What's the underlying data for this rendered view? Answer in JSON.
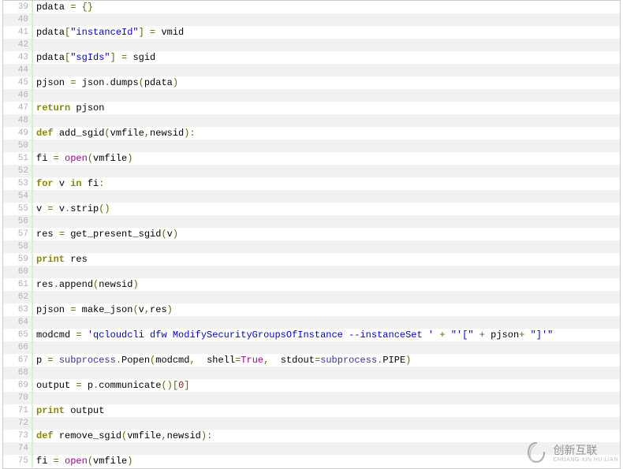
{
  "startLine": 39,
  "watermark": {
    "main": "创新互联",
    "sub": "CHUANG XIN HU LIAN"
  },
  "lines": [
    [
      {
        "t": "pdata",
        "c": "id"
      },
      {
        "t": " "
      },
      {
        "t": "=",
        "c": "op"
      },
      {
        "t": " "
      },
      {
        "t": "{}",
        "c": "punc"
      }
    ],
    [],
    [
      {
        "t": "pdata",
        "c": "id"
      },
      {
        "t": "[",
        "c": "punc"
      },
      {
        "t": "\"instanceId\"",
        "c": "str"
      },
      {
        "t": "]",
        "c": "punc"
      },
      {
        "t": " "
      },
      {
        "t": "=",
        "c": "op"
      },
      {
        "t": " "
      },
      {
        "t": "vmid",
        "c": "id"
      }
    ],
    [],
    [
      {
        "t": "pdata",
        "c": "id"
      },
      {
        "t": "[",
        "c": "punc"
      },
      {
        "t": "\"sgIds\"",
        "c": "str"
      },
      {
        "t": "]",
        "c": "punc"
      },
      {
        "t": " "
      },
      {
        "t": "=",
        "c": "op"
      },
      {
        "t": " "
      },
      {
        "t": "sgid",
        "c": "id"
      }
    ],
    [],
    [
      {
        "t": "pjson",
        "c": "id"
      },
      {
        "t": " "
      },
      {
        "t": "=",
        "c": "op"
      },
      {
        "t": " "
      },
      {
        "t": "json",
        "c": "id"
      },
      {
        "t": ".",
        "c": "punc"
      },
      {
        "t": "dumps",
        "c": "id"
      },
      {
        "t": "(",
        "c": "punc"
      },
      {
        "t": "pdata",
        "c": "id"
      },
      {
        "t": ")",
        "c": "punc"
      }
    ],
    [],
    [
      {
        "t": "return",
        "c": "kw"
      },
      {
        "t": " "
      },
      {
        "t": "pjson",
        "c": "id"
      }
    ],
    [],
    [
      {
        "t": "def",
        "c": "def"
      },
      {
        "t": " "
      },
      {
        "t": "add_sgid",
        "c": "id"
      },
      {
        "t": "(",
        "c": "punc"
      },
      {
        "t": "vmfile",
        "c": "id"
      },
      {
        "t": ",",
        "c": "punc"
      },
      {
        "t": "newsid",
        "c": "id"
      },
      {
        "t": ")",
        "c": "punc"
      },
      {
        "t": ":",
        "c": "punc"
      }
    ],
    [],
    [
      {
        "t": "fi",
        "c": "id"
      },
      {
        "t": " "
      },
      {
        "t": "=",
        "c": "op"
      },
      {
        "t": " "
      },
      {
        "t": "open",
        "c": "builtin"
      },
      {
        "t": "(",
        "c": "punc"
      },
      {
        "t": "vmfile",
        "c": "id"
      },
      {
        "t": ")",
        "c": "punc"
      }
    ],
    [],
    [
      {
        "t": "for",
        "c": "kw"
      },
      {
        "t": " "
      },
      {
        "t": "v",
        "c": "id"
      },
      {
        "t": " "
      },
      {
        "t": "in",
        "c": "kw"
      },
      {
        "t": " "
      },
      {
        "t": "fi",
        "c": "id"
      },
      {
        "t": ":",
        "c": "punc"
      }
    ],
    [],
    [
      {
        "t": "v",
        "c": "id"
      },
      {
        "t": " "
      },
      {
        "t": "=",
        "c": "op"
      },
      {
        "t": " "
      },
      {
        "t": "v",
        "c": "id"
      },
      {
        "t": ".",
        "c": "punc"
      },
      {
        "t": "strip",
        "c": "id"
      },
      {
        "t": "()",
        "c": "punc"
      }
    ],
    [],
    [
      {
        "t": "res",
        "c": "id"
      },
      {
        "t": " "
      },
      {
        "t": "=",
        "c": "op"
      },
      {
        "t": " "
      },
      {
        "t": "get_present_sgid",
        "c": "id"
      },
      {
        "t": "(",
        "c": "punc"
      },
      {
        "t": "v",
        "c": "id"
      },
      {
        "t": ")",
        "c": "punc"
      }
    ],
    [],
    [
      {
        "t": "print",
        "c": "kw"
      },
      {
        "t": " "
      },
      {
        "t": "res",
        "c": "id"
      }
    ],
    [],
    [
      {
        "t": "res",
        "c": "id"
      },
      {
        "t": ".",
        "c": "punc"
      },
      {
        "t": "append",
        "c": "id"
      },
      {
        "t": "(",
        "c": "punc"
      },
      {
        "t": "newsid",
        "c": "id"
      },
      {
        "t": ")",
        "c": "punc"
      }
    ],
    [],
    [
      {
        "t": "pjson",
        "c": "id"
      },
      {
        "t": " "
      },
      {
        "t": "=",
        "c": "op"
      },
      {
        "t": " "
      },
      {
        "t": "make_json",
        "c": "id"
      },
      {
        "t": "(",
        "c": "punc"
      },
      {
        "t": "v",
        "c": "id"
      },
      {
        "t": ",",
        "c": "punc"
      },
      {
        "t": "res",
        "c": "id"
      },
      {
        "t": ")",
        "c": "punc"
      }
    ],
    [],
    [
      {
        "t": "modcmd",
        "c": "id"
      },
      {
        "t": " "
      },
      {
        "t": "=",
        "c": "op"
      },
      {
        "t": " "
      },
      {
        "t": "'qcloudcli dfw ModifySecurityGroupsOfInstance --instanceSet '",
        "c": "str"
      },
      {
        "t": " "
      },
      {
        "t": "+",
        "c": "op"
      },
      {
        "t": " "
      },
      {
        "t": "\"'[\"",
        "c": "str"
      },
      {
        "t": " "
      },
      {
        "t": "+",
        "c": "op"
      },
      {
        "t": " "
      },
      {
        "t": "pjson",
        "c": "id"
      },
      {
        "t": "+",
        "c": "op"
      },
      {
        "t": " "
      },
      {
        "t": "\"]'\"",
        "c": "str"
      }
    ],
    [],
    [
      {
        "t": "p",
        "c": "id"
      },
      {
        "t": " "
      },
      {
        "t": "=",
        "c": "op"
      },
      {
        "t": " "
      },
      {
        "t": "subprocess",
        "c": "fn"
      },
      {
        "t": ".",
        "c": "punc"
      },
      {
        "t": "Popen",
        "c": "id"
      },
      {
        "t": "(",
        "c": "punc"
      },
      {
        "t": "modcmd",
        "c": "id"
      },
      {
        "t": ",",
        "c": "punc"
      },
      {
        "t": "  "
      },
      {
        "t": "shell",
        "c": "id"
      },
      {
        "t": "=",
        "c": "op"
      },
      {
        "t": "True",
        "c": "builtin"
      },
      {
        "t": ",",
        "c": "punc"
      },
      {
        "t": "  "
      },
      {
        "t": "stdout",
        "c": "id"
      },
      {
        "t": "=",
        "c": "op"
      },
      {
        "t": "subprocess",
        "c": "fn"
      },
      {
        "t": ".",
        "c": "punc"
      },
      {
        "t": "PIPE",
        "c": "id"
      },
      {
        "t": ")",
        "c": "punc"
      }
    ],
    [],
    [
      {
        "t": "output",
        "c": "id"
      },
      {
        "t": " "
      },
      {
        "t": "=",
        "c": "op"
      },
      {
        "t": " "
      },
      {
        "t": "p",
        "c": "id"
      },
      {
        "t": ".",
        "c": "punc"
      },
      {
        "t": "communicate",
        "c": "id"
      },
      {
        "t": "()",
        "c": "punc"
      },
      {
        "t": "[",
        "c": "punc"
      },
      {
        "t": "0",
        "c": "num"
      },
      {
        "t": "]",
        "c": "punc"
      }
    ],
    [],
    [
      {
        "t": "print",
        "c": "kw"
      },
      {
        "t": " "
      },
      {
        "t": "output",
        "c": "id"
      }
    ],
    [],
    [
      {
        "t": "def",
        "c": "def"
      },
      {
        "t": " "
      },
      {
        "t": "remove_sgid",
        "c": "id"
      },
      {
        "t": "(",
        "c": "punc"
      },
      {
        "t": "vmfile",
        "c": "id"
      },
      {
        "t": ",",
        "c": "punc"
      },
      {
        "t": "newsid",
        "c": "id"
      },
      {
        "t": ")",
        "c": "punc"
      },
      {
        "t": ":",
        "c": "punc"
      }
    ],
    [],
    [
      {
        "t": "fi",
        "c": "id"
      },
      {
        "t": " "
      },
      {
        "t": "=",
        "c": "op"
      },
      {
        "t": " "
      },
      {
        "t": "open",
        "c": "builtin"
      },
      {
        "t": "(",
        "c": "punc"
      },
      {
        "t": "vmfile",
        "c": "id"
      },
      {
        "t": ")",
        "c": "punc"
      }
    ]
  ]
}
